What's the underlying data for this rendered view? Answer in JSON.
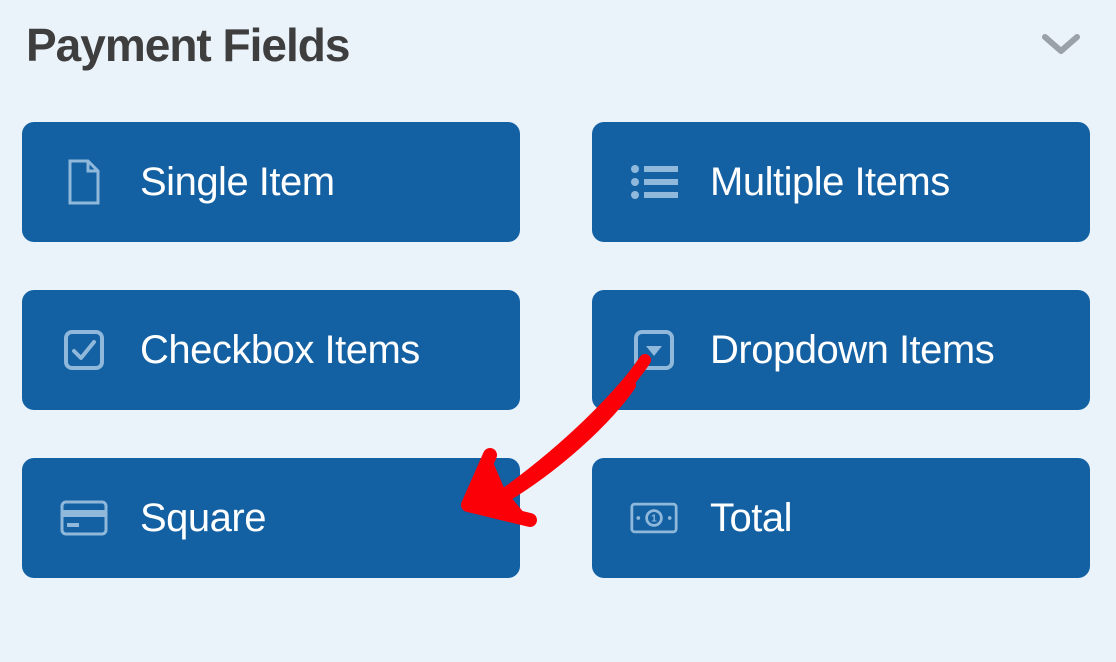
{
  "section": {
    "title": "Payment Fields"
  },
  "fields": {
    "single_item": "Single Item",
    "multiple_items": "Multiple Items",
    "checkbox_items": "Checkbox Items",
    "dropdown_items": "Dropdown Items",
    "square": "Square",
    "total": "Total"
  }
}
